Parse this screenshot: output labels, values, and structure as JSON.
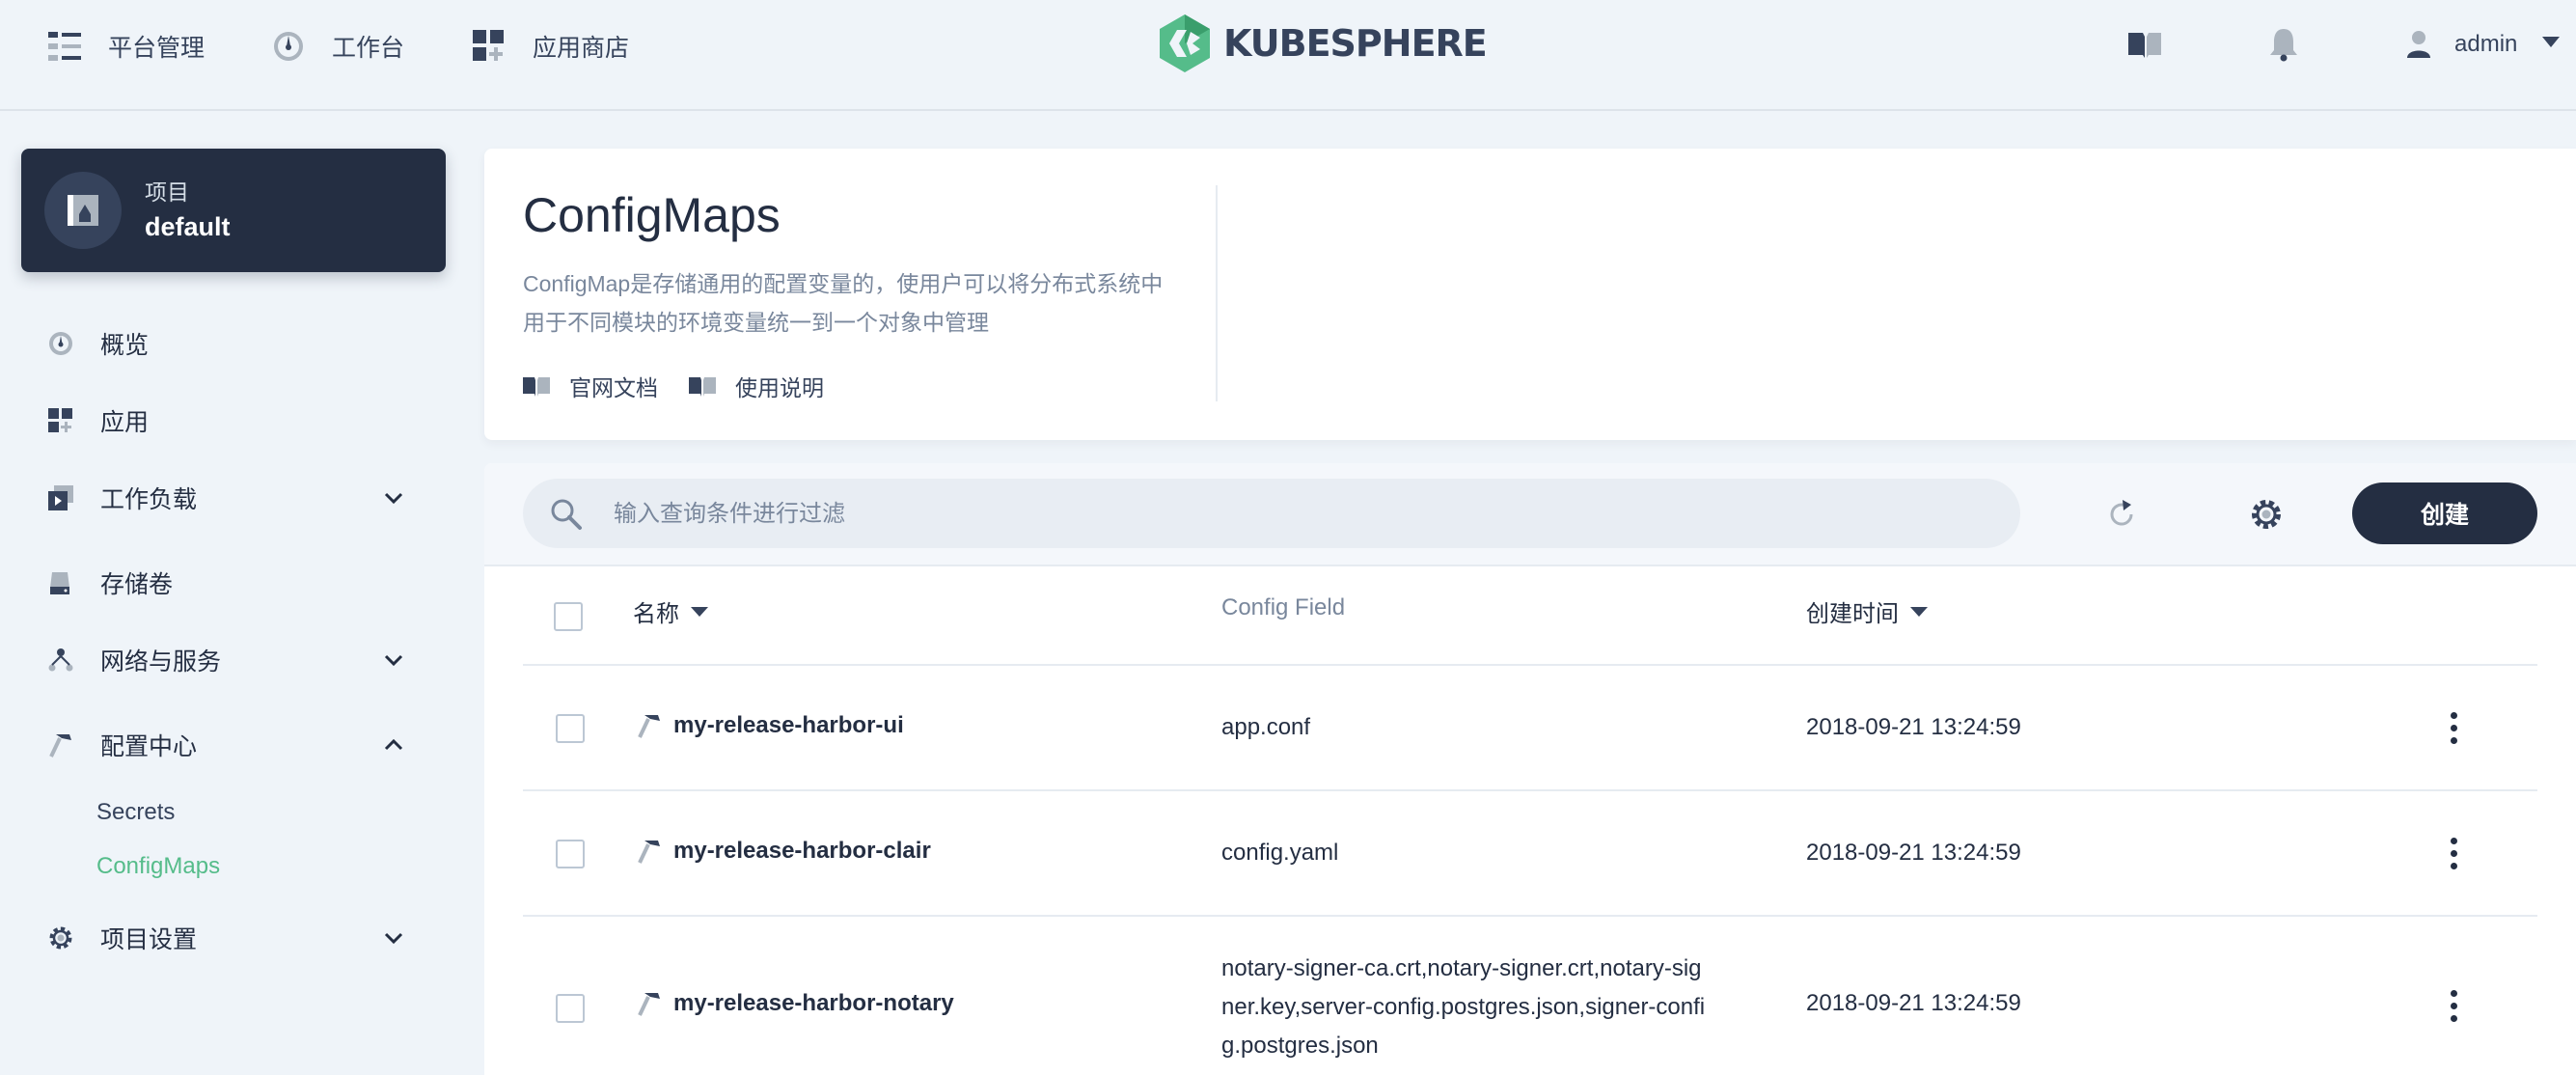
{
  "topnav": {
    "platform_label": "平台管理",
    "workbench_label": "工作台",
    "appstore_label": "应用商店",
    "brand_text": "KUBESPHERE",
    "user_name": "admin"
  },
  "sidebar": {
    "project_type": "项目",
    "project_name": "default",
    "items": [
      {
        "label": "概览",
        "icon": "dashboard-icon"
      },
      {
        "label": "应用",
        "icon": "apps-icon"
      },
      {
        "label": "工作负载",
        "icon": "workload-icon",
        "expandable": true
      },
      {
        "label": "存储卷",
        "icon": "storage-icon"
      },
      {
        "label": "网络与服务",
        "icon": "network-icon",
        "expandable": true
      },
      {
        "label": "配置中心",
        "icon": "hammer-icon",
        "expanded": true
      },
      {
        "label": "项目设置",
        "icon": "gear-icon",
        "expandable": true
      }
    ],
    "sub_items": [
      {
        "label": "Secrets",
        "active": false
      },
      {
        "label": "ConfigMaps",
        "active": true
      }
    ]
  },
  "header": {
    "title": "ConfigMaps",
    "description_line1": "ConfigMap是存储通用的配置变量的，使用户可以将分布式系统中",
    "description_line2": "用于不同模块的环境变量统一到一个对象中管理",
    "doc_link": "官网文档",
    "usage_link": "使用说明"
  },
  "toolbar": {
    "search_placeholder": "输入查询条件进行过滤",
    "create_label": "创建"
  },
  "table": {
    "columns": [
      "名称",
      "Config Field",
      "创建时间"
    ],
    "rows": [
      {
        "name": "my-release-harbor-ui",
        "field_lines": [
          "app.conf"
        ],
        "created": "2018-09-21 13:24:59"
      },
      {
        "name": "my-release-harbor-clair",
        "field_lines": [
          "config.yaml"
        ],
        "created": "2018-09-21 13:24:59"
      },
      {
        "name": "my-release-harbor-notary",
        "field_lines": [
          "notary-signer-ca.crt,notary-signer.crt,notary-sig",
          "ner.key,server-config.postgres.json,signer-confi",
          "g.postgres.json"
        ],
        "created": "2018-09-21 13:24:59"
      }
    ]
  },
  "colors": {
    "accent_green": "#55bc8a",
    "dark": "#242e42",
    "bg": "#eff4f9"
  }
}
